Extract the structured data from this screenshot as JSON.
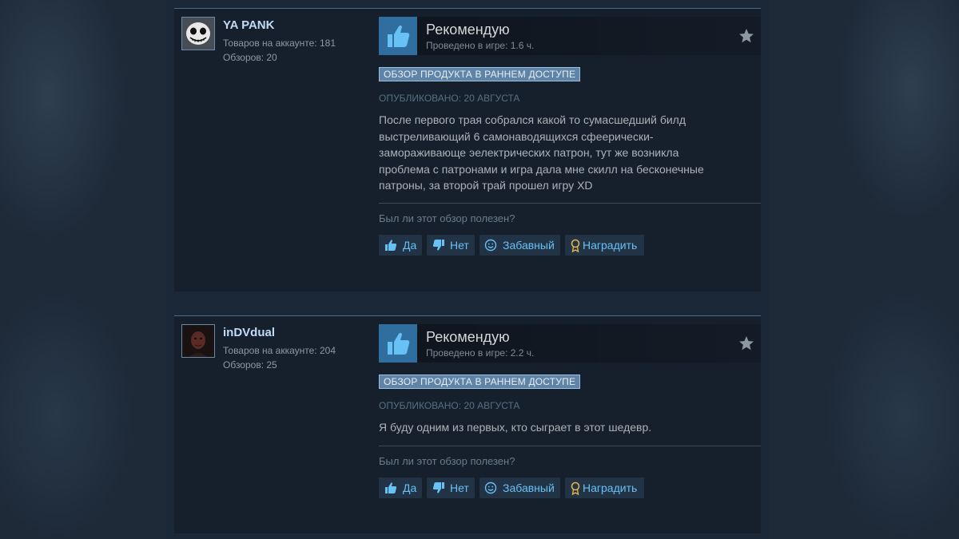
{
  "reviews": [
    {
      "persona": "YA PANK",
      "products_label": "Товаров на аккаунте: 181",
      "reviews_label": "Обзоров: 20",
      "vote_title": "Рекомендую",
      "hours": "Проведено в игре: 1.6 ч.",
      "badge": "ОБЗОР ПРОДУКТА В РАННЕМ ДОСТУПЕ",
      "posted": "ОПУБЛИКОВАНО: 20 АВГУСТА",
      "text": [
        "После первого трая собрался какой то сумасшедший билд",
        "выстреливающий 6 самонаводящихся сфеерически-",
        "замораживающе эелектрических патрон, тут же возникла",
        "проблема с патронами и игра дала мне скилл на бесконечные",
        "патроны, за второй трай прошел игру XD"
      ],
      "helpful_question": "Был ли этот обзор полезен?",
      "buttons": {
        "yes": "Да",
        "no": "Нет",
        "funny": "Забавный",
        "award": "Наградить"
      }
    },
    {
      "persona": "inDVdual",
      "products_label": "Товаров на аккаунте: 204",
      "reviews_label": "Обзоров: 25",
      "vote_title": "Рекомендую",
      "hours": "Проведено в игре: 2.2 ч.",
      "badge": "ОБЗОР ПРОДУКТА В РАННЕМ ДОСТУПЕ",
      "posted": "ОПУБЛИКОВАНО: 20 АВГУСТА",
      "text": [
        "Я буду одним из первых, кто сыграет в этот шедевр."
      ],
      "helpful_question": "Был ли этот обзор полезен?",
      "buttons": {
        "yes": "Да",
        "no": "Нет",
        "funny": "Забавный",
        "award": "Наградить"
      }
    }
  ],
  "colors": {
    "accent": "#67c1f5",
    "thumb_bg": "#2f6e9e",
    "badge_bg": "#5f84a8",
    "award_icon": "#e0b34a"
  },
  "icons": [
    "thumbs-up-icon",
    "thumbs-down-icon",
    "smile-icon",
    "award-icon",
    "star-icon"
  ]
}
